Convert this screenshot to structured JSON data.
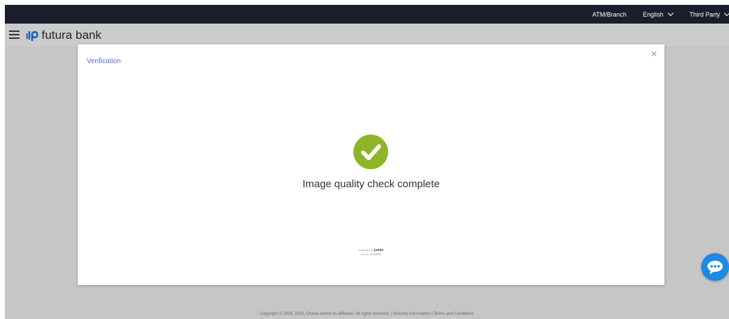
{
  "topbar": {
    "atm_branch": "ATM/Branch",
    "language": "English",
    "third_party": "Third Party"
  },
  "header": {
    "brand": "futura bank"
  },
  "modal": {
    "title": "Verification",
    "message": "Image quality check complete",
    "powered_by_prefix": "Powered by",
    "powered_by_brand": "jumio",
    "version": "v2.1.0-20190830"
  },
  "footer": {
    "copyright": "Copyright © 2006, 2020, Oracle and/or its affiliates. All rights reserved. | Security Information | Terms and Conditions"
  },
  "colors": {
    "topbar_bg": "#1a1e2c",
    "success_green": "#8db527",
    "chat_blue": "#1e88e5",
    "title_color": "#5c6ac0"
  },
  "icons": {
    "menu": "hamburger-icon",
    "language_dropdown": "chevron-down-icon",
    "close": "close-icon",
    "success": "check-circle-icon",
    "chat": "chat-bubble-icon"
  }
}
